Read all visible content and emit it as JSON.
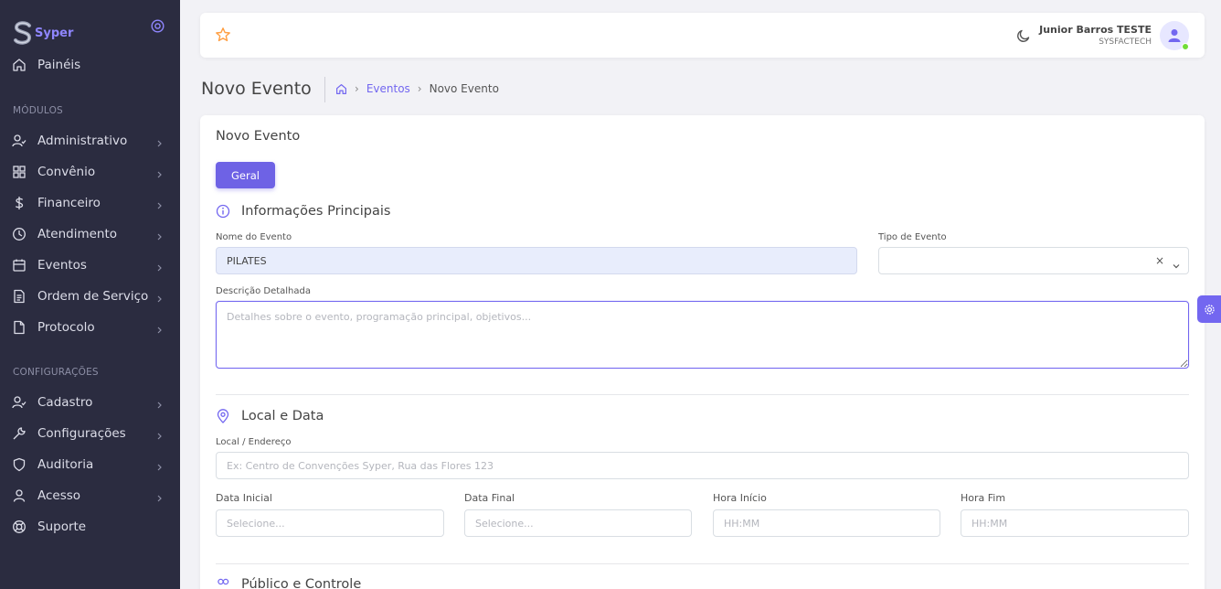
{
  "brand": {
    "name": "Syper"
  },
  "sidebar": {
    "dashboard": {
      "label": "Painéis"
    },
    "section_modules": "MÓDULOS",
    "modules": [
      {
        "label": "Administrativo",
        "icon": "user-check-icon"
      },
      {
        "label": "Convênio",
        "icon": "grid-icon"
      },
      {
        "label": "Financeiro",
        "icon": "dollar-icon"
      },
      {
        "label": "Atendimento",
        "icon": "clock-icon"
      },
      {
        "label": "Eventos",
        "icon": "calendar-icon"
      },
      {
        "label": "Ordem de Serviço",
        "icon": "document-list-icon"
      },
      {
        "label": "Protocolo",
        "icon": "file-icon"
      }
    ],
    "section_config": "CONFIGURAÇÕES",
    "config": [
      {
        "label": "Cadastro",
        "icon": "user-check-icon"
      },
      {
        "label": "Configurações",
        "icon": "wrench-icon"
      },
      {
        "label": "Auditoria",
        "icon": "shield-icon"
      },
      {
        "label": "Acesso",
        "icon": "user-icon"
      },
      {
        "label": "Suporte",
        "icon": "lifebuoy-icon"
      }
    ]
  },
  "topbar": {
    "user_name": "Junior Barros TESTE",
    "user_company": "SYSFACTECH"
  },
  "header": {
    "title": "Novo Evento",
    "breadcrumb": {
      "link": "Eventos",
      "current": "Novo Evento"
    }
  },
  "form": {
    "card_title": "Novo Evento",
    "tab_label": "Geral",
    "section_main": "Informações Principais",
    "event_name_label": "Nome do Evento",
    "event_name_value": "PILATES",
    "event_type_label": "Tipo de Evento",
    "description_label": "Descrição Detalhada",
    "description_placeholder": "Detalhes sobre o evento, programação principal, objetivos...",
    "section_location": "Local e Data",
    "location_label": "Local / Endereço",
    "location_placeholder": "Ex: Centro de Convenções Syper, Rua das Flores 123",
    "start_date_label": "Data Inicial",
    "start_date_placeholder": "Selecione...",
    "end_date_label": "Data Final",
    "end_date_placeholder": "Selecione...",
    "start_time_label": "Hora Início",
    "start_time_placeholder": "HH:MM",
    "end_time_label": "Hora Fim",
    "end_time_placeholder": "HH:MM",
    "section_audience": "Público e Controle"
  },
  "colors": {
    "sidebar_bg": "#2b2c40",
    "accent": "#7367f0",
    "star": "#ff9f43"
  }
}
